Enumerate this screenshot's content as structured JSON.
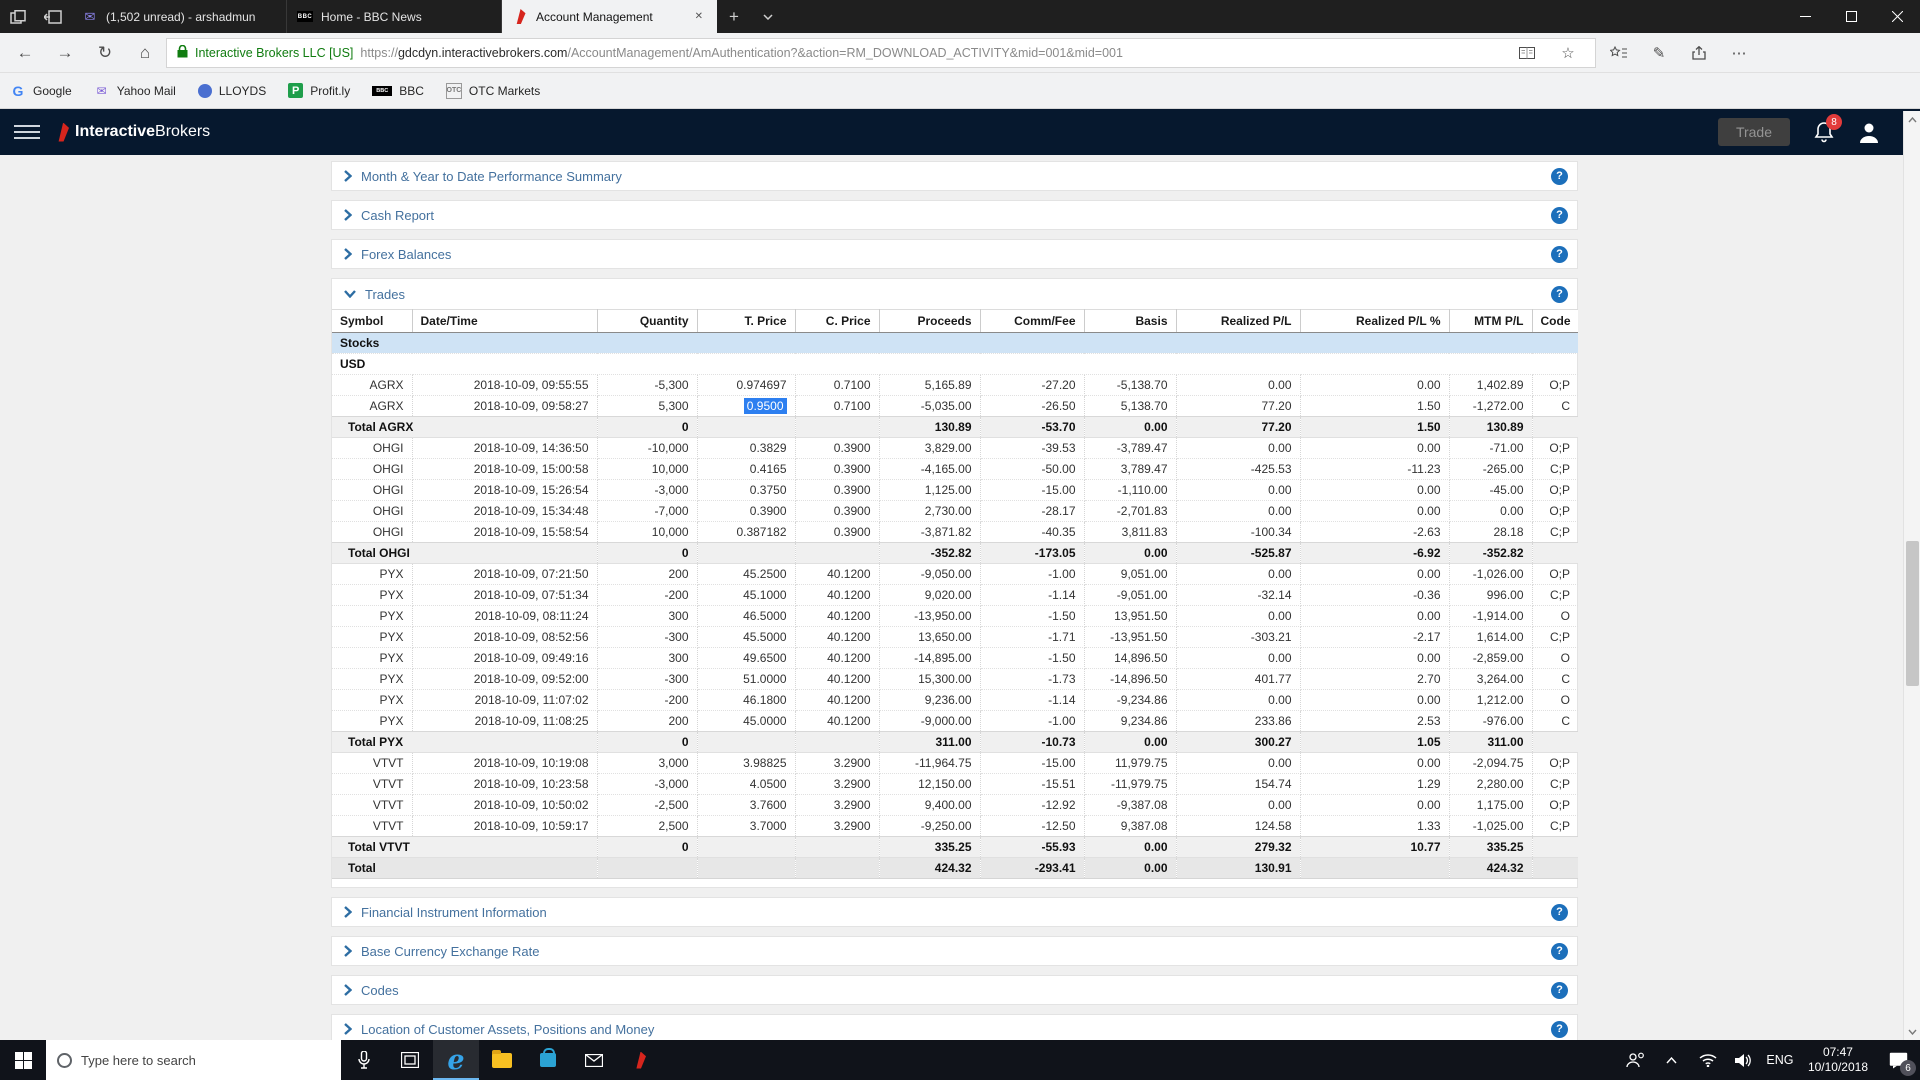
{
  "browser": {
    "tabs": [
      {
        "title": "(1,502 unread) - arshadmun",
        "icon": "mail",
        "active": false
      },
      {
        "title": "Home - BBC News",
        "icon": "bbc",
        "active": false
      },
      {
        "title": "Account Management",
        "icon": "ib-flame",
        "active": true
      }
    ],
    "url": {
      "security_label": "Interactive Brokers LLC [US]",
      "protocol": "https://",
      "domain": "gdcdyn.interactivebrokers.com",
      "path": "/AccountManagement/AmAuthentication?&action=RM_DOWNLOAD_ACTIVITY&mid=001&mid=001"
    },
    "bookmarks": [
      {
        "label": "Google",
        "icon": "google"
      },
      {
        "label": "Yahoo Mail",
        "icon": "yahoo-mail"
      },
      {
        "label": "LLOYDS",
        "icon": "lloyds"
      },
      {
        "label": "Profit.ly",
        "icon": "profitly"
      },
      {
        "label": "BBC",
        "icon": "bbc"
      },
      {
        "label": "OTC Markets",
        "icon": "otc"
      }
    ]
  },
  "navbar": {
    "brand_bold": "Interactive",
    "brand_regular": "Brokers",
    "trade_button": "Trade",
    "notification_count": "8"
  },
  "sections_top": [
    "Month & Year to Date Performance Summary",
    "Cash Report",
    "Forex Balances"
  ],
  "trades_section_title": "Trades",
  "table": {
    "columns": [
      "Symbol",
      "Date/Time",
      "Quantity",
      "T. Price",
      "C. Price",
      "Proceeds",
      "Comm/Fee",
      "Basis",
      "Realized P/L",
      "Realized P/L %",
      "MTM P/L",
      "Code"
    ],
    "rows": [
      {
        "t": "group",
        "label": "Stocks"
      },
      {
        "t": "currency",
        "label": "USD"
      },
      {
        "t": "data",
        "cells": [
          "AGRX",
          "2018-10-09, 09:55:55",
          "-5,300",
          "0.974697",
          "0.7100",
          "5,165.89",
          "-27.20",
          "-5,138.70",
          "0.00",
          "0.00",
          "1,402.89",
          "O;P"
        ]
      },
      {
        "t": "data",
        "sel": 3,
        "cells": [
          "AGRX",
          "2018-10-09, 09:58:27",
          "5,300",
          "0.9500",
          "0.7100",
          "-5,035.00",
          "-26.50",
          "5,138.70",
          "77.20",
          "1.50",
          "-1,272.00",
          "C"
        ]
      },
      {
        "t": "total",
        "label": "Total AGRX",
        "values": [
          "0",
          "",
          "",
          "130.89",
          "-53.70",
          "0.00",
          "77.20",
          "1.50",
          "130.89",
          ""
        ]
      },
      {
        "t": "data",
        "cells": [
          "OHGI",
          "2018-10-09, 14:36:50",
          "-10,000",
          "0.3829",
          "0.3900",
          "3,829.00",
          "-39.53",
          "-3,789.47",
          "0.00",
          "0.00",
          "-71.00",
          "O;P"
        ]
      },
      {
        "t": "data",
        "cells": [
          "OHGI",
          "2018-10-09, 15:00:58",
          "10,000",
          "0.4165",
          "0.3900",
          "-4,165.00",
          "-50.00",
          "3,789.47",
          "-425.53",
          "-11.23",
          "-265.00",
          "C;P"
        ]
      },
      {
        "t": "data",
        "cells": [
          "OHGI",
          "2018-10-09, 15:26:54",
          "-3,000",
          "0.3750",
          "0.3900",
          "1,125.00",
          "-15.00",
          "-1,110.00",
          "0.00",
          "0.00",
          "-45.00",
          "O;P"
        ]
      },
      {
        "t": "data",
        "cells": [
          "OHGI",
          "2018-10-09, 15:34:48",
          "-7,000",
          "0.3900",
          "0.3900",
          "2,730.00",
          "-28.17",
          "-2,701.83",
          "0.00",
          "0.00",
          "0.00",
          "O;P"
        ]
      },
      {
        "t": "data",
        "cells": [
          "OHGI",
          "2018-10-09, 15:58:54",
          "10,000",
          "0.387182",
          "0.3900",
          "-3,871.82",
          "-40.35",
          "3,811.83",
          "-100.34",
          "-2.63",
          "28.18",
          "C;P"
        ]
      },
      {
        "t": "total",
        "label": "Total OHGI",
        "values": [
          "0",
          "",
          "",
          "-352.82",
          "-173.05",
          "0.00",
          "-525.87",
          "-6.92",
          "-352.82",
          ""
        ]
      },
      {
        "t": "data",
        "cells": [
          "PYX",
          "2018-10-09, 07:21:50",
          "200",
          "45.2500",
          "40.1200",
          "-9,050.00",
          "-1.00",
          "9,051.00",
          "0.00",
          "0.00",
          "-1,026.00",
          "O;P"
        ]
      },
      {
        "t": "data",
        "cells": [
          "PYX",
          "2018-10-09, 07:51:34",
          "-200",
          "45.1000",
          "40.1200",
          "9,020.00",
          "-1.14",
          "-9,051.00",
          "-32.14",
          "-0.36",
          "996.00",
          "C;P"
        ]
      },
      {
        "t": "data",
        "cells": [
          "PYX",
          "2018-10-09, 08:11:24",
          "300",
          "46.5000",
          "40.1200",
          "-13,950.00",
          "-1.50",
          "13,951.50",
          "0.00",
          "0.00",
          "-1,914.00",
          "O"
        ]
      },
      {
        "t": "data",
        "cells": [
          "PYX",
          "2018-10-09, 08:52:56",
          "-300",
          "45.5000",
          "40.1200",
          "13,650.00",
          "-1.71",
          "-13,951.50",
          "-303.21",
          "-2.17",
          "1,614.00",
          "C;P"
        ]
      },
      {
        "t": "data",
        "cells": [
          "PYX",
          "2018-10-09, 09:49:16",
          "300",
          "49.6500",
          "40.1200",
          "-14,895.00",
          "-1.50",
          "14,896.50",
          "0.00",
          "0.00",
          "-2,859.00",
          "O"
        ]
      },
      {
        "t": "data",
        "cells": [
          "PYX",
          "2018-10-09, 09:52:00",
          "-300",
          "51.0000",
          "40.1200",
          "15,300.00",
          "-1.73",
          "-14,896.50",
          "401.77",
          "2.70",
          "3,264.00",
          "C"
        ]
      },
      {
        "t": "data",
        "cells": [
          "PYX",
          "2018-10-09, 11:07:02",
          "-200",
          "46.1800",
          "40.1200",
          "9,236.00",
          "-1.14",
          "-9,234.86",
          "0.00",
          "0.00",
          "1,212.00",
          "O"
        ]
      },
      {
        "t": "data",
        "cells": [
          "PYX",
          "2018-10-09, 11:08:25",
          "200",
          "45.0000",
          "40.1200",
          "-9,000.00",
          "-1.00",
          "9,234.86",
          "233.86",
          "2.53",
          "-976.00",
          "C"
        ]
      },
      {
        "t": "total",
        "label": "Total PYX",
        "values": [
          "0",
          "",
          "",
          "311.00",
          "-10.73",
          "0.00",
          "300.27",
          "1.05",
          "311.00",
          ""
        ]
      },
      {
        "t": "data",
        "cells": [
          "VTVT",
          "2018-10-09, 10:19:08",
          "3,000",
          "3.98825",
          "3.2900",
          "-11,964.75",
          "-15.00",
          "11,979.75",
          "0.00",
          "0.00",
          "-2,094.75",
          "O;P"
        ]
      },
      {
        "t": "data",
        "cells": [
          "VTVT",
          "2018-10-09, 10:23:58",
          "-3,000",
          "4.0500",
          "3.2900",
          "12,150.00",
          "-15.51",
          "-11,979.75",
          "154.74",
          "1.29",
          "2,280.00",
          "C;P"
        ]
      },
      {
        "t": "data",
        "cells": [
          "VTVT",
          "2018-10-09, 10:50:02",
          "-2,500",
          "3.7600",
          "3.2900",
          "9,400.00",
          "-12.92",
          "-9,387.08",
          "0.00",
          "0.00",
          "1,175.00",
          "O;P"
        ]
      },
      {
        "t": "data",
        "cells": [
          "VTVT",
          "2018-10-09, 10:59:17",
          "2,500",
          "3.7000",
          "3.2900",
          "-9,250.00",
          "-12.50",
          "9,387.08",
          "124.58",
          "1.33",
          "-1,025.00",
          "C;P"
        ]
      },
      {
        "t": "total",
        "label": "Total VTVT",
        "values": [
          "0",
          "",
          "",
          "335.25",
          "-55.93",
          "0.00",
          "279.32",
          "10.77",
          "335.25",
          ""
        ]
      },
      {
        "t": "grand",
        "label": "Total",
        "values": [
          "",
          "",
          "",
          "424.32",
          "-293.41",
          "0.00",
          "130.91",
          "",
          "424.32",
          ""
        ]
      }
    ]
  },
  "sections_bottom": [
    "Financial Instrument Information",
    "Base Currency Exchange Rate",
    "Codes",
    "Location of Customer Assets, Positions and Money"
  ],
  "taskbar": {
    "search_placeholder": "Type here to search",
    "language": "ENG",
    "time": "07:47",
    "date": "10/10/2018",
    "notification_badge": "6"
  },
  "colors": {
    "security_green": "#107c10",
    "section_link_blue": "#44719e",
    "help_icon_blue": "#1c6fbb",
    "notification_red": "#e23b3b",
    "selection_blue": "#2d7ff0",
    "group_row_blue": "#cfe3f5",
    "navbar_navy": "#06182e"
  }
}
